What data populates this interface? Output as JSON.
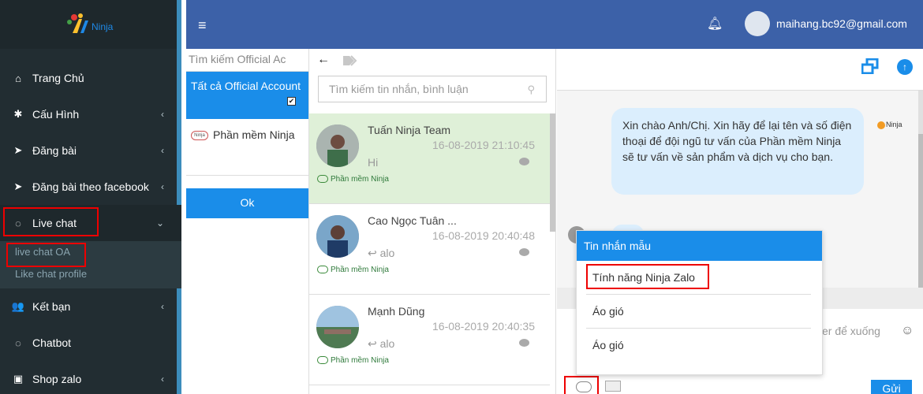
{
  "sidebar": {
    "logo_text": "Ninja",
    "items": [
      {
        "label": "Trang Chủ",
        "icon": "home-icon"
      },
      {
        "label": "Cấu Hình",
        "icon": "gear-icon",
        "chevron": "‹"
      },
      {
        "label": "Đăng bài",
        "icon": "send-icon",
        "chevron": "‹"
      },
      {
        "label": "Đăng bài theo facebook",
        "icon": "send-icon",
        "chevron": "‹"
      },
      {
        "label": "Live chat",
        "icon": "chat-bubble-icon",
        "chevron": "⌄"
      },
      {
        "label": "Kết bạn",
        "icon": "users-icon",
        "chevron": "‹"
      },
      {
        "label": "Chatbot",
        "icon": "chat-bubble-icon"
      },
      {
        "label": "Shop zalo",
        "icon": "shopping-bag-icon",
        "chevron": "‹"
      }
    ],
    "sub_items": [
      {
        "label": "live chat OA"
      },
      {
        "label": "Like chat profile"
      }
    ]
  },
  "topbar": {
    "menu_icon": "hamburger-icon",
    "bell_icon": "bell-icon",
    "user_email": "maihang.bc92@gmail.com"
  },
  "accounts_panel": {
    "search_placeholder": "Tìm kiếm Official Ac",
    "all_label": "Tất cả Official Account",
    "items": [
      {
        "label": "Phần mềm Ninja"
      }
    ],
    "ok_label": "Ok"
  },
  "conversations": {
    "search_placeholder": "Tìm kiếm tin nhắn, bình luận",
    "items": [
      {
        "name": "Tuấn Ninja Team",
        "time": "16-08-2019 21:10:45",
        "message": "Hi",
        "source": "Phần mềm Ninja",
        "selected": true
      },
      {
        "name": "Cao Ngọc Tuân ...",
        "time": "16-08-2019 20:40:48",
        "message": "alo",
        "source": "Phần mềm Ninja",
        "reply": true
      },
      {
        "name": "Mạnh Dũng",
        "time": "16-08-2019 20:40:35",
        "message": "alo",
        "source": "Phần mềm Ninja",
        "reply": true
      }
    ]
  },
  "chat": {
    "bot_message": "Xin chào Anh/Chị. Xin hãy để lại tên và số điện thoại để đội ngũ tư vấn của Phần mềm Ninja sẽ tư vấn về sản phẩm và dịch vụ cho bạn.",
    "bot_name": "Ninja",
    "composer_hint": "er để xuống",
    "send_label": "Gửi"
  },
  "template_popup": {
    "title": "Tin nhắn mẫu",
    "items": [
      {
        "label": "Tính năng Ninja Zalo",
        "highlighted": true
      },
      {
        "label": "Áo gió"
      },
      {
        "label": "Áo gió"
      }
    ]
  },
  "colors": {
    "sidebar_bg": "#222d32",
    "topbar_bg": "#3c61a8",
    "accent": "#1a8de9",
    "selected_row": "#dff0d8",
    "highlight_box": "#e00000"
  }
}
